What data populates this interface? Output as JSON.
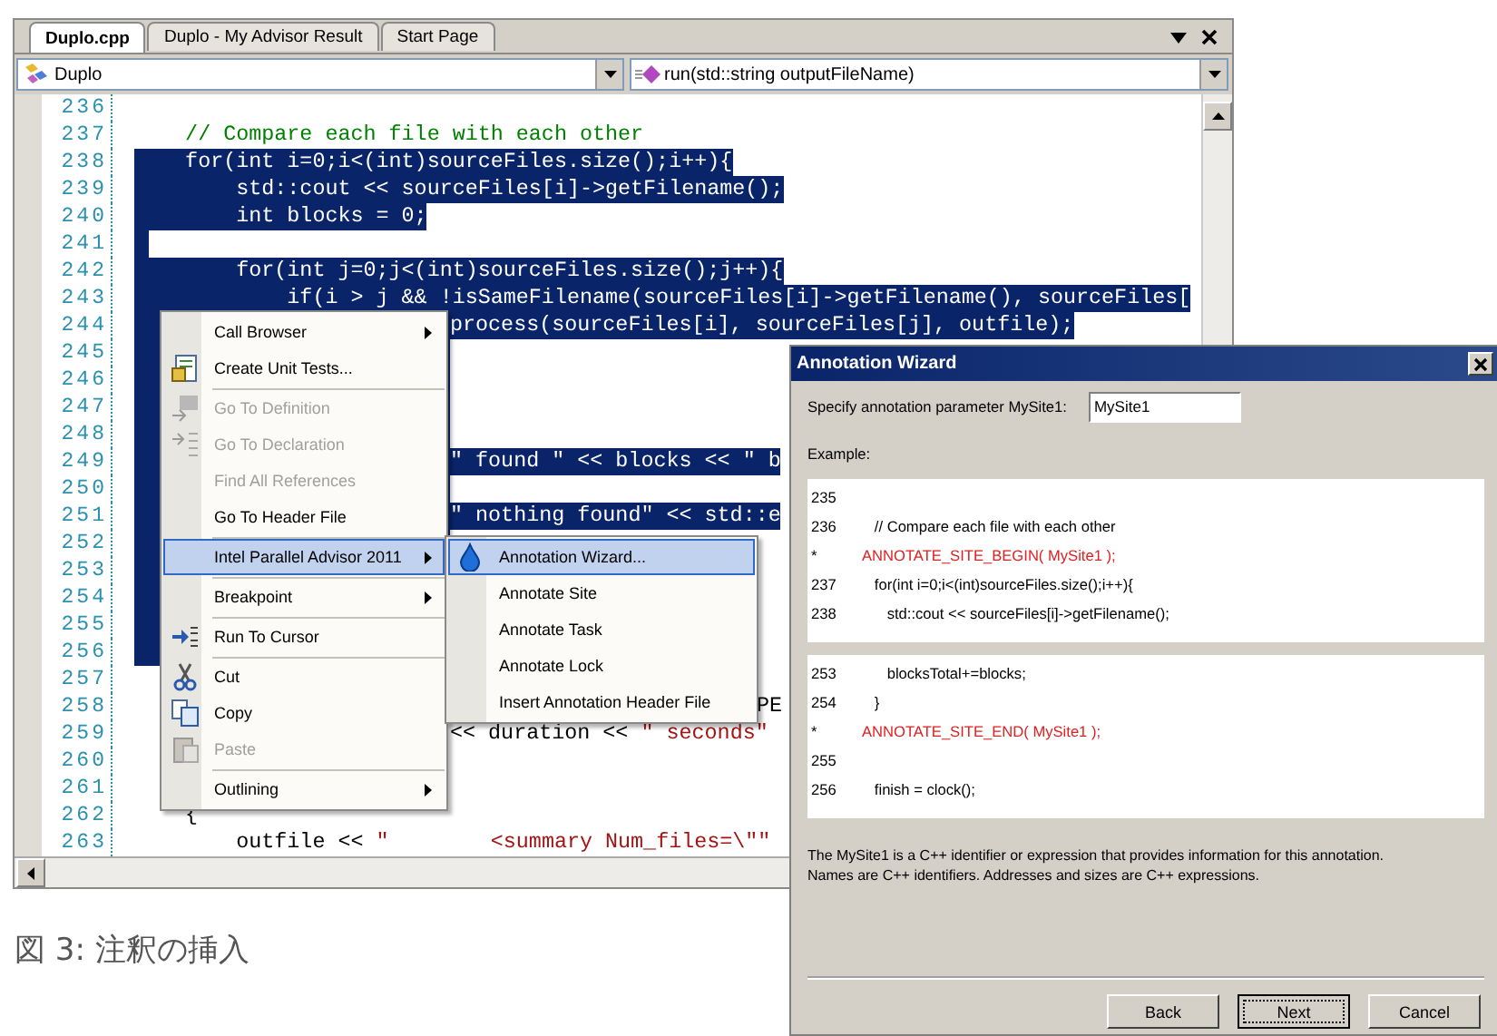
{
  "tabs": [
    {
      "label": "Duplo.cpp",
      "selected": true
    },
    {
      "label": "Duplo - My Advisor Result",
      "selected": false
    },
    {
      "label": "Start Page",
      "selected": false
    }
  ],
  "scope_dropdown": {
    "value": "Duplo"
  },
  "member_dropdown": {
    "value": "run(std::string outputFileName)"
  },
  "code_lines": [
    {
      "number": "236",
      "selected": false,
      "kind": "full"
    },
    {
      "number": "237",
      "selected": false,
      "kind": "full",
      "parts": [
        {
          "text": "    // Compare each file with each other",
          "kind": "comment"
        }
      ]
    },
    {
      "number": "238",
      "selected": true,
      "kind": "full",
      "parts": [
        {
          "text": "    for(int i=0;i<(int)sourceFiles.size();i++){",
          "kind": "code"
        }
      ]
    },
    {
      "number": "239",
      "selected": true,
      "kind": "full",
      "parts": [
        {
          "text": "        std::cout << sourceFiles[i]->getFilename();",
          "kind": "code"
        }
      ]
    },
    {
      "number": "240",
      "selected": true,
      "kind": "full",
      "parts": [
        {
          "text": "        int blocks = 0;",
          "kind": "code"
        }
      ]
    },
    {
      "number": "241",
      "selected": true,
      "kind": "full"
    },
    {
      "number": "242",
      "selected": true,
      "kind": "full",
      "parts": [
        {
          "text": "        for(int j=0;j<(int)sourceFiles.size();j++){",
          "kind": "code"
        }
      ]
    },
    {
      "number": "243",
      "selected": true,
      "kind": "full",
      "parts": [
        {
          "text": "            if(i > j && !isSameFilename(sourceFiles[i]->getFilename(), sourceFiles[",
          "kind": "code"
        }
      ]
    },
    {
      "number": "244",
      "selected": true,
      "kind": "after-menu",
      "parts": [
        {
          "text": "process(sourceFiles[i], sourceFiles[j], outfile);",
          "kind": "code"
        }
      ]
    },
    {
      "number": "245",
      "selected": true,
      "kind": "after-menu"
    },
    {
      "number": "246",
      "selected": true,
      "kind": "after-menu"
    },
    {
      "number": "247",
      "selected": true,
      "kind": "after-menu"
    },
    {
      "number": "248",
      "selected": true,
      "kind": "after-menu"
    },
    {
      "number": "249",
      "selected": true,
      "kind": "after-menu",
      "parts": [
        {
          "text": "\" found \" << blocks << \" b",
          "kind": "code"
        }
      ]
    },
    {
      "number": "250",
      "selected": true,
      "kind": "after-menu"
    },
    {
      "number": "251",
      "selected": true,
      "kind": "after-menu",
      "parts": [
        {
          "text": "\" nothing found\" << std::e",
          "kind": "code"
        }
      ]
    },
    {
      "number": "252",
      "selected": true,
      "kind": "after-menu"
    },
    {
      "number": "253",
      "selected": true,
      "kind": "after-menu"
    },
    {
      "number": "254",
      "selected": true,
      "kind": "after-menu"
    },
    {
      "number": "255",
      "selected": true,
      "kind": "after-menu"
    },
    {
      "number": "256",
      "selected": true,
      "kind": "after-menu"
    },
    {
      "number": "257",
      "selected": false,
      "kind": "full"
    },
    {
      "number": "258",
      "selected": false,
      "kind": "after-submenu",
      "parts": [
        {
          "text": "PE",
          "kind": "code"
        }
      ]
    },
    {
      "number": "259",
      "selected": false,
      "kind": "after-menu",
      "parts": [
        {
          "text": "<< duration << ",
          "kind": "code"
        },
        {
          "text": "\" seconds\"",
          "kind": "string"
        }
      ]
    },
    {
      "number": "260",
      "selected": false,
      "kind": "full"
    },
    {
      "number": "261",
      "selected": false,
      "kind": "full"
    },
    {
      "number": "262",
      "selected": false,
      "kind": "full",
      "parts": [
        {
          "text": "    {",
          "kind": "code"
        }
      ]
    },
    {
      "number": "263",
      "selected": false,
      "kind": "full",
      "parts": [
        {
          "text": "        outfile << ",
          "kind": "code"
        },
        {
          "text": "\"        <summary Num_files=\\\"\"",
          "kind": "string"
        }
      ]
    }
  ],
  "context_menu": {
    "items": [
      {
        "kind": "plain",
        "label": "Call Browser",
        "disabled": false,
        "selected": false,
        "has_submenu": true
      },
      {
        "kind": "tests",
        "label": "Create Unit Tests...",
        "disabled": false,
        "selected": false,
        "has_submenu": false
      },
      {
        "kind": "separator"
      },
      {
        "kind": "definition",
        "label": "Go To Definition",
        "disabled": true,
        "selected": false,
        "has_submenu": false
      },
      {
        "kind": "declaration",
        "label": "Go To Declaration",
        "disabled": true,
        "selected": false,
        "has_submenu": false
      },
      {
        "kind": "plain",
        "label": "Find All References",
        "disabled": true,
        "selected": false,
        "has_submenu": false
      },
      {
        "kind": "plain",
        "label": "Go To Header File",
        "disabled": false,
        "selected": false,
        "has_submenu": false
      },
      {
        "kind": "separator"
      },
      {
        "kind": "plain",
        "label": "Intel Parallel Advisor 2011",
        "disabled": false,
        "selected": true,
        "has_submenu": true
      },
      {
        "kind": "separator"
      },
      {
        "kind": "plain",
        "label": "Breakpoint",
        "disabled": false,
        "selected": false,
        "has_submenu": true
      },
      {
        "kind": "separator"
      },
      {
        "kind": "run",
        "label": "Run To Cursor",
        "disabled": false,
        "selected": false,
        "has_submenu": false
      },
      {
        "kind": "separator"
      },
      {
        "kind": "cut",
        "label": "Cut",
        "disabled": false,
        "selected": false,
        "has_submenu": false
      },
      {
        "kind": "copy",
        "label": "Copy",
        "disabled": false,
        "selected": false,
        "has_submenu": false
      },
      {
        "kind": "paste",
        "label": "Paste",
        "disabled": true,
        "selected": false,
        "has_submenu": false
      },
      {
        "kind": "separator"
      },
      {
        "kind": "plain",
        "label": "Outlining",
        "disabled": false,
        "selected": false,
        "has_submenu": true
      }
    ]
  },
  "submenu": {
    "items": [
      {
        "kind": "drop",
        "label": "Annotation Wizard...",
        "selected": true
      },
      {
        "kind": "plain",
        "label": "Annotate Site",
        "selected": false
      },
      {
        "kind": "plain",
        "label": "Annotate Task",
        "selected": false
      },
      {
        "kind": "plain",
        "label": "Annotate Lock",
        "selected": false
      },
      {
        "kind": "plain",
        "label": "Insert Annotation Header File",
        "selected": false
      }
    ]
  },
  "dialog": {
    "title": "Annotation Wizard",
    "parameter_label": "Specify annotation parameter MySite1:",
    "parameter_value": "MySite1",
    "example_label": "Example:",
    "example_blocks": [
      [
        {
          "number": "235"
        },
        {
          "number": "236",
          "text": "   // Compare each file with each other",
          "kind": "code"
        },
        {
          "number": "*",
          "text": "ANNOTATE_SITE_BEGIN( MySite1 );",
          "kind": "inserted"
        },
        {
          "number": "237",
          "text": "   for(int i=0;i<(int)sourceFiles.size();i++){",
          "kind": "code"
        },
        {
          "number": "238",
          "text": "      std::cout << sourceFiles[i]->getFilename();",
          "kind": "code"
        }
      ],
      [
        {
          "number": "253",
          "text": "      blocksTotal+=blocks;",
          "kind": "code"
        },
        {
          "number": "254",
          "text": "   }",
          "kind": "code"
        },
        {
          "number": "*",
          "text": "ANNOTATE_SITE_END( MySite1 );",
          "kind": "inserted"
        },
        {
          "number": "255"
        },
        {
          "number": "256",
          "text": "   finish = clock();",
          "kind": "code"
        }
      ]
    ],
    "description": [
      "The MySite1 is a C++ identifier or expression that provides information for this annotation.",
      "Names are C++ identifiers. Addresses and sizes are C++ expressions."
    ],
    "buttons": [
      {
        "label": "Back",
        "focused": false
      },
      {
        "label": "Next",
        "focused": true
      },
      {
        "label": "Cancel",
        "focused": false
      }
    ]
  },
  "caption": "図 3: 注釈の挿入"
}
